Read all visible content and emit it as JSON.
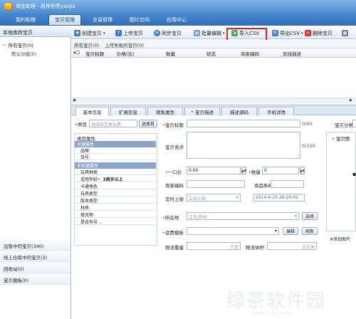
{
  "window": {
    "title": "淘宝助理 - 愿样狗秀yaojie"
  },
  "nav": {
    "tabs": [
      "我的助理",
      "宝贝管理",
      "交易管理",
      "图片空间",
      "应用中心"
    ]
  },
  "toolbar": {
    "create": "创建宝贝",
    "upload": "上传宝贝",
    "sync": "同步宝贝",
    "batch_edit": "批量编辑",
    "import_csv": "导入CSV",
    "export_csv": "导出CSV",
    "delete": "删除宝贝"
  },
  "sidebar": {
    "header": "本地库存宝贝",
    "tree_root": "所有宝贝(0)",
    "tree_child": "默认分组(0)",
    "bottom_items": [
      "出售中的宝贝(340)",
      "线上仓库中的宝贝(3)",
      "回收站(0)",
      "宝贝模板(0)"
    ]
  },
  "list": {
    "breadcrumb_all": "所有宝贝(0)",
    "breadcrumb_failed": "上传失败的宝贝(0)",
    "columns": [
      "宝贝标题",
      "价格(元)",
      "数量",
      "状态",
      "商家编码",
      "无线描述"
    ]
  },
  "detail_tabs": [
    "基本信息",
    "扩展信息",
    "销售属性",
    "宝贝描述",
    "描述源码",
    "手机详情"
  ],
  "form": {
    "category_label": "类目",
    "category_value": "毛绒布艺类玩具",
    "select_category": "选类目",
    "title_label": "宝贝标题",
    "title_count": "0/60",
    "selling_label": "宝贝卖点",
    "selling_count": "0/150",
    "price_label": "一口价",
    "price_value": "0.00",
    "qty_label": "数量",
    "qty_value": "0",
    "merchant_code_label": "商家编码",
    "barcode_label": "商品条码",
    "schedule_label": "定时上架",
    "schedule_option": "立刻上架",
    "schedule_time": "2014-6-25 20:24:02",
    "location_label": "所在地",
    "location_value": "江苏/扬州",
    "location_button": "选择",
    "shipping_label": "运费模板",
    "edit_button": "编辑",
    "refresh_button": "刷新",
    "weight_label": "物流重量",
    "weight_unit": "千克",
    "volume_label": "物流体积",
    "volume_unit": "立方米",
    "category_tab": "宝贝分类",
    "picture_title": "宝贝图",
    "add_picture": "添加图片"
  },
  "properties": {
    "header": "类目属性",
    "key_section": "关键属性",
    "key_items": [
      "品牌",
      "货号"
    ],
    "nonkey_section": "非关键属性",
    "nonkey_items": [
      "玩具种类",
      "适用年龄",
      "卡通角色",
      "玩具类型",
      "版本类型",
      "材质",
      "填充物",
      "是否有导…"
    ],
    "age_value": "3周岁以上"
  },
  "watermark": {
    "text": "绿茶软件园",
    "url": "www.33LC.com"
  },
  "colors": {
    "highlight": "#e0242a",
    "nav_bg": "#2f6db8",
    "accent": "#4f8fd2"
  }
}
